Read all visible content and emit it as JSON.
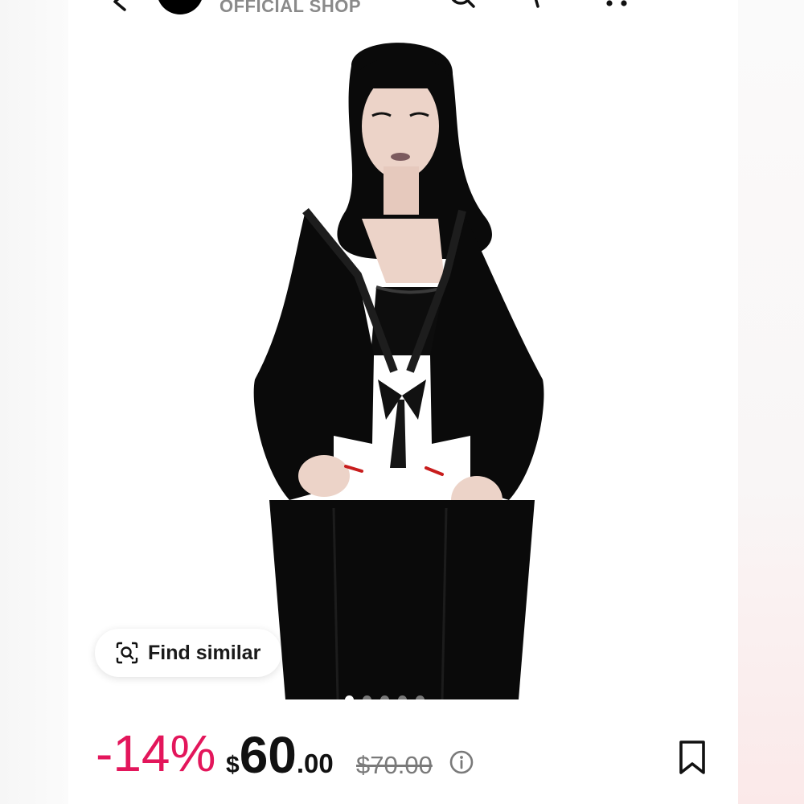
{
  "header": {
    "shop_label": "OFFICIAL SHOP",
    "icons": [
      "back-icon",
      "shop-avatar",
      "search-icon",
      "share-icon",
      "more-icon"
    ]
  },
  "gallery": {
    "find_similar_label": "Find similar",
    "page_dots_count": 5,
    "active_dot_index": 0,
    "colors": {
      "garment": "#0a0a0a",
      "skin": "#ecd3c8",
      "lips": "#7b5a5e",
      "nails": "#c81d1d"
    }
  },
  "price": {
    "discount": "-14%",
    "currency": "$",
    "amount_int": "60",
    "amount_dec": ".00",
    "original": "$70.00"
  },
  "colors": {
    "discount": "#e3165b",
    "price_text": "#111111",
    "muted": "#7a7a7a"
  }
}
